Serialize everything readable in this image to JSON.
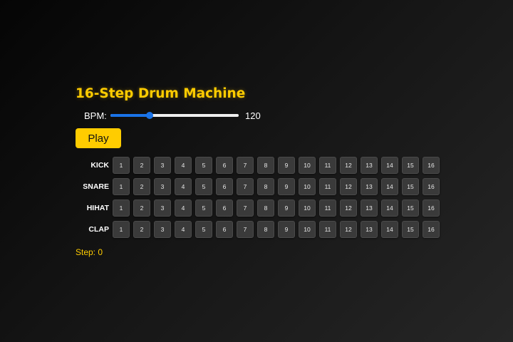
{
  "app": {
    "title": "16-Step Drum Machine"
  },
  "bpm": {
    "label": "BPM:",
    "value": 120,
    "value_text": "120",
    "min": 40,
    "max": 300
  },
  "controls": {
    "play_label": "Play"
  },
  "tracks": [
    {
      "name": "KICK"
    },
    {
      "name": "SNARE"
    },
    {
      "name": "HIHAT"
    },
    {
      "name": "CLAP"
    }
  ],
  "steps": [
    "1",
    "2",
    "3",
    "4",
    "5",
    "6",
    "7",
    "8",
    "9",
    "10",
    "11",
    "12",
    "13",
    "14",
    "15",
    "16"
  ],
  "status": {
    "text": "Step: 0"
  },
  "colors": {
    "accent": "#ffcc00",
    "slider": "#1a73e8",
    "step_inactive": "#3a3a3a"
  }
}
